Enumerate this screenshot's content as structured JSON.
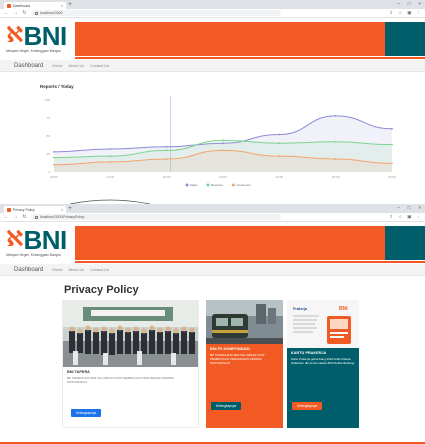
{
  "colors": {
    "brand_orange": "#f15a22",
    "brand_teal": "#005e6a",
    "button_blue": "#1a73e8",
    "series_purple": "#8e8cd8",
    "series_green": "#7dd48f",
    "series_orange": "#f5a36c"
  },
  "icons": [
    "bni-logo",
    "lock-icon",
    "close-icon",
    "plus-icon",
    "back-icon",
    "forward-icon",
    "reload-icon"
  ],
  "site": {
    "logo_text": "BNI",
    "logo_mark": "ℵ",
    "logo_subtitle": "Melayani Negeri, Kebanggaan Bangsa"
  },
  "browser1": {
    "tab_title": "Dashboard",
    "url": "localhost:3000"
  },
  "nav1": {
    "brand": "Dashboard",
    "links": [
      "Home",
      "About Us",
      "Contact Us"
    ]
  },
  "chart_data": {
    "type": "line",
    "title": "Reports / Today",
    "x": [
      "00:00",
      "01:00",
      "02:00",
      "03:00",
      "04:00",
      "05:00",
      "06:00"
    ],
    "series": [
      {
        "name": "Sales",
        "values": [
          28,
          32,
          35,
          40,
          52,
          78,
          60
        ]
      },
      {
        "name": "Revenue",
        "values": [
          20,
          22,
          30,
          44,
          40,
          42,
          38
        ]
      },
      {
        "name": "Customers",
        "values": [
          10,
          14,
          18,
          30,
          22,
          18,
          12
        ]
      }
    ],
    "ylim": [
      0,
      100
    ],
    "legend": "bottom",
    "grid": false
  },
  "browser2": {
    "tab_title": "Privacy Policy",
    "url": "localhost:3000/PrivacyPolicy"
  },
  "nav2": {
    "brand": "Dashboard",
    "links": [
      "Home",
      "About Us",
      "Contact Us"
    ]
  },
  "privacy": {
    "title": "Privacy Policy",
    "cards": [
      {
        "title": "BNI TAPERA",
        "text": "BP TAPERA DAN BNI SALURKAN FLPP PEMBIAYAAN PERUMAHAN KEPADA MASYARAKAT",
        "button": "Selengkapnya"
      },
      {
        "title": "BNI FX KOMPONDASI",
        "text": "BP TAPERA DAN BNI SALURKAN FLPP PEMBIAYAAN PERUMAHAN KEPADA MASYARAKAT",
        "button": "Selengkapnya"
      },
      {
        "title": "KARTU PRAKERJA",
        "text": "Kartu Prakerja gelombang 2023 telah dibuka. Daftarkan diri Anda melalui BNI Mobile Banking.",
        "button": "Selengkapnya",
        "image_label": "Prakerja",
        "image_brand": "BNI"
      }
    ]
  }
}
